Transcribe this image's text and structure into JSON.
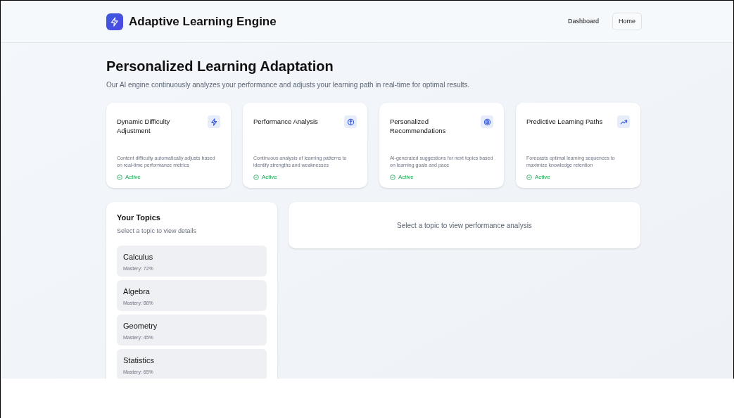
{
  "header": {
    "title": "Adaptive Learning Engine",
    "nav": [
      {
        "label": "Dashboard",
        "selected": false
      },
      {
        "label": "Home",
        "selected": true
      }
    ]
  },
  "heading": "Personalized Learning Adaptation",
  "subtitle": "Our AI engine continuously analyzes your performance and adjusts your learning path in real-time for optimal results.",
  "features": [
    {
      "title": "Dynamic Difficulty Adjustment",
      "description": "Content difficulty automatically adjusts based on real-time performance metrics",
      "status": "Active"
    },
    {
      "title": "Performance Analysis",
      "description": "Continuous analysis of learning patterns to identify strengths and weaknesses",
      "status": "Active"
    },
    {
      "title": "Personalized Recommendations",
      "description": "AI-generated suggestions for next topics based on learning goals and pace",
      "status": "Active"
    },
    {
      "title": "Predictive Learning Paths",
      "description": "Forecasts optimal learning sequences to maximize knowledge retention",
      "status": "Active"
    }
  ],
  "topics": {
    "title": "Your Topics",
    "subtitle": "Select a topic to view details",
    "items": [
      {
        "name": "Calculus",
        "mastery": "Mastery: 72%"
      },
      {
        "name": "Algebra",
        "mastery": "Mastery: 88%"
      },
      {
        "name": "Geometry",
        "mastery": "Mastery: 45%"
      },
      {
        "name": "Statistics",
        "mastery": "Mastery: 65%"
      }
    ]
  },
  "analysis": {
    "placeholder": "Select a topic to view performance analysis"
  }
}
